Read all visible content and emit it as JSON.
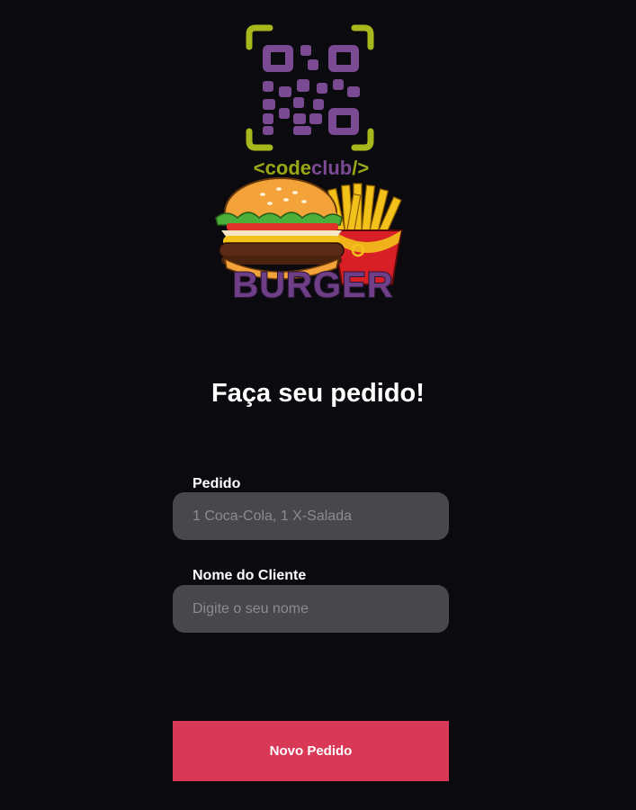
{
  "logo": {
    "brand_text": "<codeclub/>",
    "product_text": "BURGER",
    "colors": {
      "frame": "#a7b81c",
      "qr": "#7a4a93",
      "code": "#9aa817",
      "club": "#7a4a93",
      "burger_text": "#6e3e86"
    },
    "icons": [
      "qr-code-icon",
      "burger-icon",
      "fries-icon"
    ]
  },
  "page": {
    "title": "Faça seu pedido!"
  },
  "form": {
    "order": {
      "label": "Pedido",
      "placeholder": "1 Coca-Cola, 1 X-Salada",
      "value": ""
    },
    "client": {
      "label": "Nome do Cliente",
      "placeholder": "Digite o seu nome",
      "value": ""
    },
    "submit_label": "Novo Pedido"
  },
  "colors": {
    "background": "#0b0a0f",
    "input_background": "#48474b",
    "button": "#d93856",
    "text": "#ffffff"
  }
}
